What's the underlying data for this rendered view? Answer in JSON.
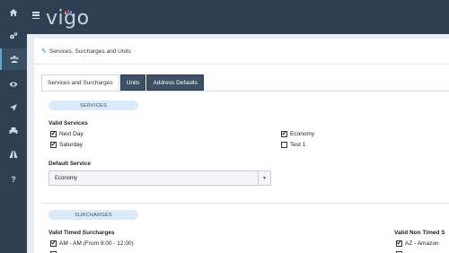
{
  "app": {
    "logo": "vigo"
  },
  "sidebar": {
    "items": [
      {
        "icon": "home-icon"
      },
      {
        "icon": "cogs-icon"
      },
      {
        "icon": "users-icon",
        "active": true
      },
      {
        "icon": "eye-icon"
      },
      {
        "icon": "location-arrow-icon"
      },
      {
        "icon": "print-icon"
      },
      {
        "icon": "road-icon"
      },
      {
        "icon": "question-icon"
      }
    ]
  },
  "breadcrumb": {
    "title": "Services, Surcharges and Units"
  },
  "tabs": [
    {
      "label": "Services and Surcharges",
      "active": true
    },
    {
      "label": "Units"
    },
    {
      "label": "Address Defaults"
    }
  ],
  "services": {
    "section_label": "SERVICES",
    "valid_label": "Valid Services",
    "options": [
      {
        "label": "Next Day",
        "checked": true
      },
      {
        "label": "Saturday",
        "checked": true
      },
      {
        "label": "Economy",
        "checked": true
      },
      {
        "label": "Test 1",
        "checked": false
      }
    ],
    "default_label": "Default Service",
    "default_value": "Economy"
  },
  "surcharges": {
    "section_label": "SURCHARGES",
    "timed_label": "Valid Timed Surcharges",
    "timed_options": [
      {
        "label": "AM - AM (From 9:00 - 12:00)",
        "checked": true
      }
    ],
    "non_timed_label": "Valid Non Timed S",
    "non_timed_options": [
      {
        "label": "AZ - Amazon",
        "checked": true
      }
    ]
  },
  "colors": {
    "sidebar": "#2f3f52",
    "accent": "#5fa8d6",
    "pill": "#dce9f6"
  }
}
